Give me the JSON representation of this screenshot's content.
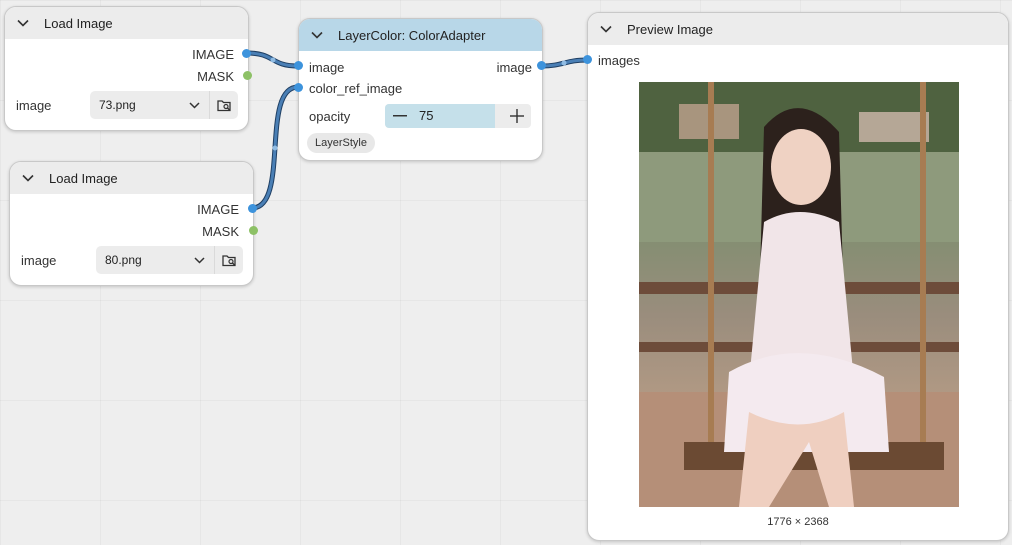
{
  "colors": {
    "image_link": "#3d93dc",
    "mask_link": "#8dc166",
    "link_stroke": "#4a7fb5",
    "selected_header": "#b8d7e8"
  },
  "node_load1": {
    "title": "Load Image",
    "outputs": [
      "IMAGE",
      "MASK"
    ],
    "widget_label": "image",
    "widget_value": "73.png",
    "collapse_icon": "chevron-down-icon",
    "folder_icon": "folder-search-icon"
  },
  "node_load2": {
    "title": "Load Image",
    "outputs": [
      "IMAGE",
      "MASK"
    ],
    "widget_label": "image",
    "widget_value": "80.png",
    "collapse_icon": "chevron-down-icon",
    "folder_icon": "folder-search-icon"
  },
  "node_adapter": {
    "title": "LayerColor: ColorAdapter",
    "inputs": [
      "image",
      "color_ref_image"
    ],
    "output": "image",
    "opacity_label": "opacity",
    "opacity_value": "75",
    "opacity_level": 0.75,
    "badge": "LayerStyle"
  },
  "node_preview": {
    "title": "Preview Image",
    "input": "images",
    "dimensions": "1776 × 2368"
  }
}
